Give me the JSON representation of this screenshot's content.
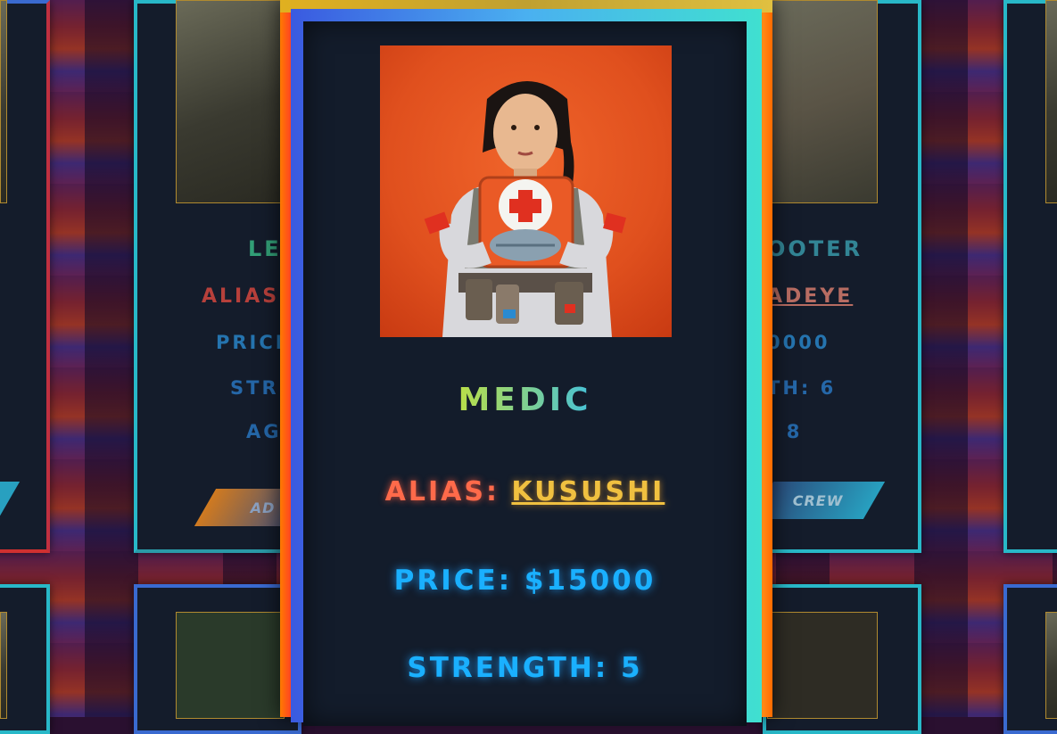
{
  "main_card": {
    "role": "MEDIC",
    "alias_label": "ALIAS:",
    "alias_value": "KUSUSHI",
    "price": "PRICE: $15000",
    "strength": "STRENGTH: 5"
  },
  "background_cards": {
    "left": {
      "role_partial": "LE",
      "alias_partial": "ALIAS:",
      "price_partial": "PRICE",
      "strength_partial": "STR",
      "agility_partial": "AG",
      "button_partial": "AD"
    },
    "right": {
      "role_partial": "OOTER",
      "alias_partial": "ADEYE",
      "price_partial": "0000",
      "strength_partial": "TH: 6",
      "agility_partial": ": 8",
      "button_partial": "CREW"
    }
  },
  "colors": {
    "accent_orange": "#ff6a4a",
    "accent_gold": "#f0c040",
    "stat_blue": "#1ab0ff",
    "card_bg": "#131c2b"
  }
}
